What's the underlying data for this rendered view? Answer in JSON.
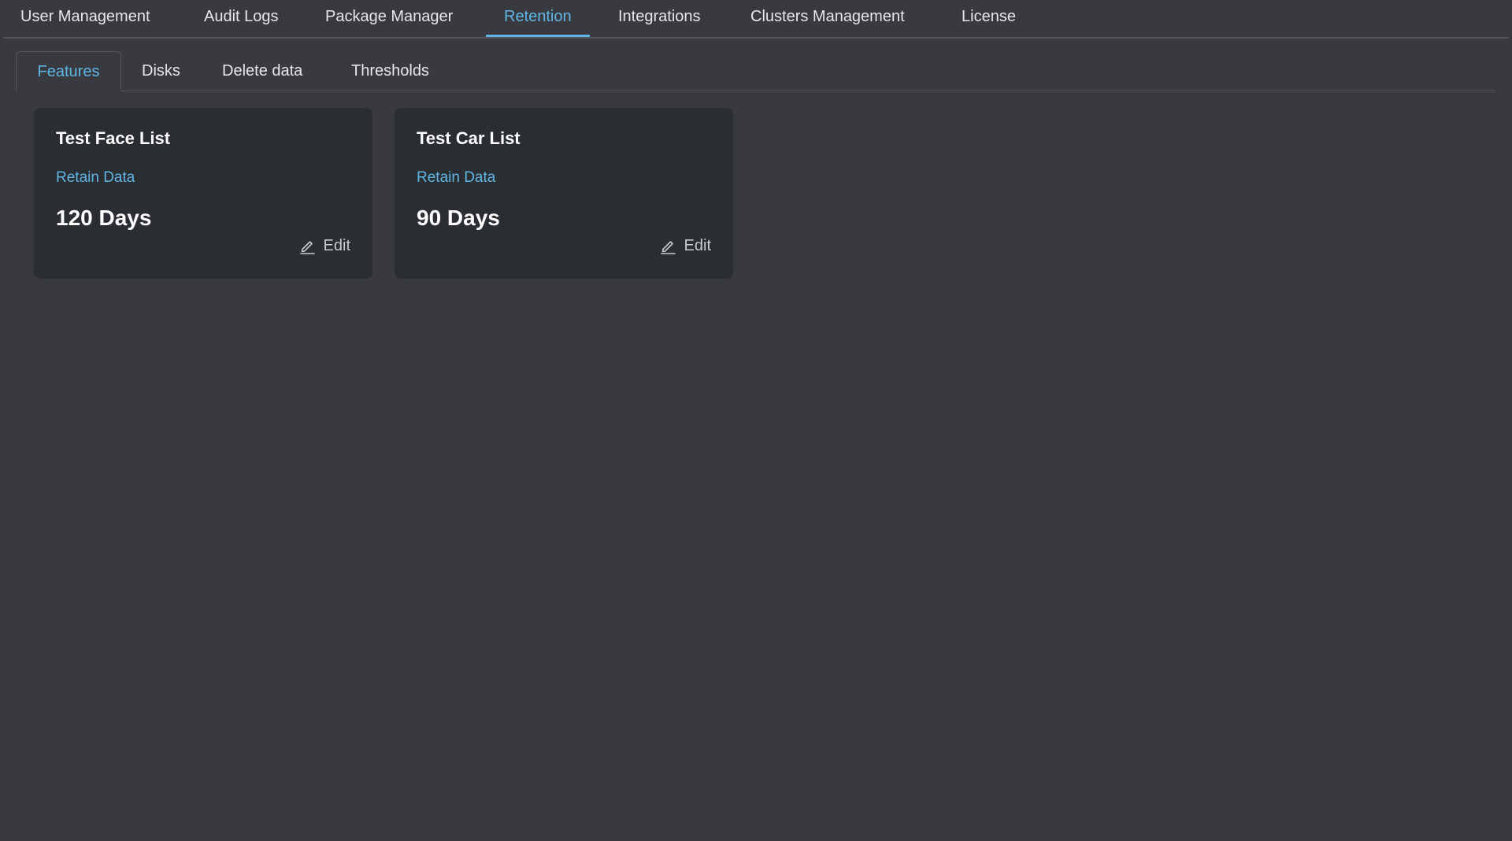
{
  "top_nav": {
    "tabs": [
      {
        "label": "User Management"
      },
      {
        "label": "Audit Logs"
      },
      {
        "label": "Package Manager"
      },
      {
        "label": "Retention",
        "active": true
      },
      {
        "label": "Integrations"
      },
      {
        "label": "Clusters Management"
      },
      {
        "label": "License"
      }
    ]
  },
  "sub_nav": {
    "tabs": [
      {
        "label": "Features",
        "active": true
      },
      {
        "label": "Disks"
      },
      {
        "label": "Delete data"
      },
      {
        "label": "Thresholds"
      }
    ]
  },
  "cards": [
    {
      "title": "Test Face List",
      "subtitle": "Retain Data",
      "value": "120 Days",
      "edit_label": "Edit"
    },
    {
      "title": "Test Car List",
      "subtitle": "Retain Data",
      "value": "90 Days",
      "edit_label": "Edit"
    }
  ],
  "colors": {
    "background": "#383a40",
    "card": "#2a2d32",
    "accent": "#5fb6e6",
    "text": "#e6e7ea"
  },
  "icons": {
    "edit": "pencil-icon"
  }
}
